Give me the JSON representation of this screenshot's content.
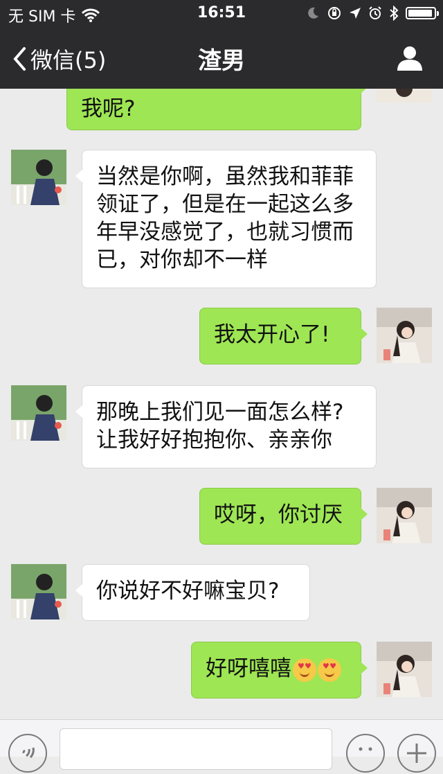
{
  "status_bar": {
    "carrier": "无 SIM 卡",
    "time": "16:51",
    "battery_level_percent": 95,
    "icons": [
      "wifi-icon",
      "moon-icon",
      "rotation-lock-icon",
      "location-icon",
      "alarm-icon",
      "bluetooth-icon",
      "battery-icon"
    ]
  },
  "nav": {
    "back_label": "微信(5)",
    "title": "渣男",
    "profile_icon": "person-icon"
  },
  "messages": [
    {
      "from": "me",
      "text": "我呢?"
    },
    {
      "from": "them",
      "lines": [
        "当然是你啊，虽然我和菲菲",
        "领证了，但是在一起这么多",
        "年早没感觉了，也就习惯而",
        "已，对你却不一样"
      ]
    },
    {
      "from": "me",
      "text": "我太开心了!"
    },
    {
      "from": "them",
      "lines": [
        "那晚上我们见一面怎么样?",
        "让我好好抱抱你、亲亲你"
      ]
    },
    {
      "from": "me",
      "text": "哎呀，你讨厌"
    },
    {
      "from": "them",
      "text": "你说好不好嘛宝贝?"
    },
    {
      "from": "me",
      "text": "好呀嘻嘻",
      "emoji": [
        "heart-eyes-emoji",
        "heart-eyes-emoji"
      ]
    }
  ],
  "input_bar": {
    "voice_icon": "voice-icon",
    "emoji_icon": "emoji-icon",
    "plus_icon": "plus-icon"
  },
  "colors": {
    "bar_bg": "#2b2b2d",
    "chat_bg": "#ebebeb",
    "me_bubble": "#9ee654",
    "them_bubble": "#ffffff"
  }
}
